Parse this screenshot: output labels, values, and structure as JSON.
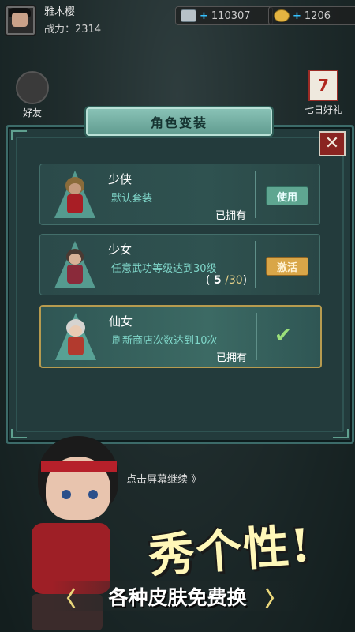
{
  "header": {
    "player_name": "雅木樱",
    "power_text": "战力：2314",
    "diamonds": "110307",
    "gold": "1206",
    "plus": "+"
  },
  "side_buttons": {
    "friends": "好友",
    "seven_day_gift": "七日好礼",
    "calendar_num": "7"
  },
  "modal": {
    "title": "角色变装",
    "close": "✕"
  },
  "skins": [
    {
      "name": "少侠",
      "description": "默认套装",
      "status": "已拥有",
      "action": "使用"
    },
    {
      "name": "少女",
      "description": "任意武功等级达到30级",
      "progress_current": "5",
      "progress_total": "/30",
      "action": "激活"
    },
    {
      "name": "仙女",
      "description": "刷新商店次数达到10次",
      "status": "已拥有",
      "check": "✔"
    }
  ],
  "continue_text": "点击屏幕继续 》",
  "promo": {
    "slogan": "秀个性!",
    "tagline": "各种皮肤免费换",
    "chevron_left": "〈",
    "chevron_right": "〉"
  }
}
